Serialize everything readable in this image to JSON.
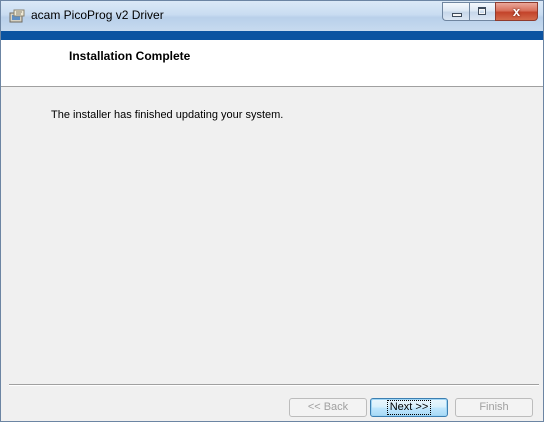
{
  "window": {
    "title": "acam PicoProg v2 Driver",
    "icons": {
      "app": "installer-icon",
      "minimize": "minimize-icon",
      "maximize": "maximize-icon",
      "close": "close-icon"
    },
    "close_glyph": "x"
  },
  "header": {
    "title": "Installation Complete"
  },
  "body": {
    "message": "The installer has finished updating your system."
  },
  "buttons": {
    "back": {
      "label": "<< Back",
      "enabled": false
    },
    "next": {
      "label": "Next >>",
      "enabled": true,
      "default": true
    },
    "finish": {
      "label": "Finish",
      "enabled": false
    }
  },
  "colors": {
    "accent_bar": "#0b53a1",
    "dialog_background": "#f0f0f0",
    "header_background": "#ffffff"
  }
}
